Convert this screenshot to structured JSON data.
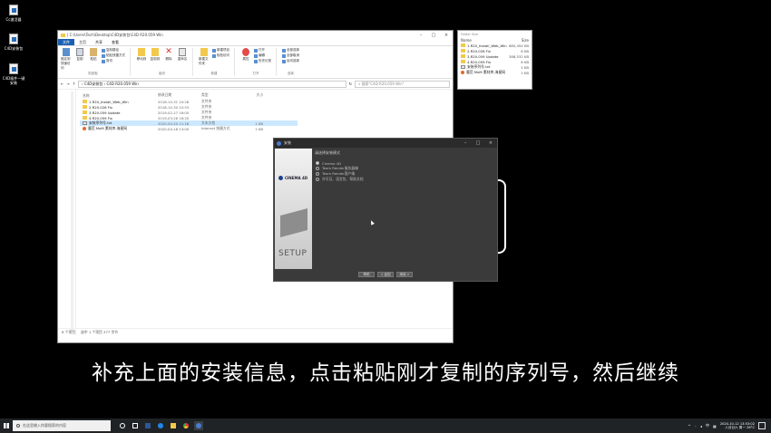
{
  "desktop": {
    "icons": [
      {
        "label": "Cc激活器"
      },
      {
        "label": "C4D安装包"
      },
      {
        "label": "C4D插件一键安装"
      }
    ]
  },
  "explorer": {
    "title_path": "| C:\\Users\\Tech\\Desktop\\C4D安装包\\C4D R20.059 Win",
    "tabs": [
      "文件",
      "主页",
      "共享",
      "查看"
    ],
    "ribbon": {
      "groups": [
        {
          "label": "剪贴板",
          "big": [
            "固定到快速访问",
            "复制",
            "粘贴"
          ],
          "small": [
            "复制路径",
            "粘贴快捷方式",
            "剪切"
          ]
        },
        {
          "label": "组织",
          "big": [
            "移动到",
            "复制到",
            "删除",
            "重命名"
          ],
          "small": []
        },
        {
          "label": "新建",
          "big": [
            "新建文件夹"
          ],
          "small": [
            "新建项目",
            "轻松访问"
          ]
        },
        {
          "label": "打开",
          "big": [
            "属性"
          ],
          "small": [
            "打开",
            "编辑",
            "历史记录"
          ]
        },
        {
          "label": "选择",
          "big": [],
          "small": [
            "全部选择",
            "全部取消",
            "反向选择"
          ]
        }
      ]
    },
    "nav": {
      "back": "←",
      "forward": "→",
      "up": "↑"
    },
    "address": "› C4D安装包 › C4D R20.059 Win",
    "refresh": "↻",
    "search_placeholder": "搜索\"C4D R20.059 Win\"",
    "columns": [
      "名称",
      "修改日期",
      "类型",
      "大小"
    ],
    "files": [
      {
        "name": "1.R20_Install_Web_Win",
        "date": "2018-10-31 10:28",
        "type": "文件夹",
        "size": "",
        "icon": "folder",
        "selected": false
      },
      {
        "name": "2.R20.026 Fix",
        "date": "2018-10-30 22:53",
        "type": "文件夹",
        "size": "",
        "icon": "folder",
        "selected": false
      },
      {
        "name": "3.R20.059 Update",
        "date": "2019-02-27 16:05",
        "type": "文件夹",
        "size": "",
        "icon": "folder",
        "selected": false
      },
      {
        "name": "4.R20.059 Fix",
        "date": "2019-03-26 16:20",
        "type": "文件夹",
        "size": "",
        "icon": "folder",
        "selected": false
      },
      {
        "name": "安装序列号.txt",
        "date": "2020-04-20 11:18",
        "type": "文本文档",
        "size": "1 KB",
        "icon": "txt",
        "selected": true
      },
      {
        "name": "魔范 MoM 素材库-海星网",
        "date": "2020-04-18 13:00",
        "type": "Internet 快捷方式",
        "size": "1 KB",
        "icon": "url",
        "selected": false
      }
    ],
    "status": {
      "count": "6 个项目",
      "selected": "选中 1 个项目  377 字节"
    }
  },
  "sidepanel": {
    "title": "Folder Size",
    "col_name": "Name",
    "col_size": "Size",
    "rows": [
      {
        "name": "1.R20_Install_Web_Win",
        "size": "680,454 KB"
      },
      {
        "name": "2.R20.026 Fix",
        "size": "6 KB"
      },
      {
        "name": "3.R20.059 Update",
        "size": "388,532 KB"
      },
      {
        "name": "4.R20.059 Fix",
        "size": "6 KB"
      },
      {
        "name": "安装序列号.txt",
        "size": "1 KB"
      },
      {
        "name": "魔范 MoM 素材库-海星网",
        "size": "1 KB"
      }
    ]
  },
  "installer": {
    "title": "安装",
    "heading": "请选择安装模式",
    "brand": "CINEMA 4D",
    "setup_text": "SETUP",
    "options": [
      {
        "label": "Cinema 4D",
        "on": true
      },
      {
        "label": "Team Render服务器端",
        "on": false
      },
      {
        "label": "Team Render客户端",
        "on": false
      },
      {
        "label": "许可证、语言包、帮助文档",
        "on": false
      }
    ],
    "buttons": {
      "help": "帮助",
      "back": "< 返回",
      "next": "继续 >"
    }
  },
  "subtitle": "补充上面的安装信息，点击粘贴刚才复制的序列号，然后继续",
  "taskbar": {
    "search_placeholder": "在这里输入你要搜索的内容",
    "tray": {
      "lang": "中",
      "clock_time": "2020-10-12 13:53:02",
      "clock_date": "八月廿六 周一 28°C"
    }
  }
}
